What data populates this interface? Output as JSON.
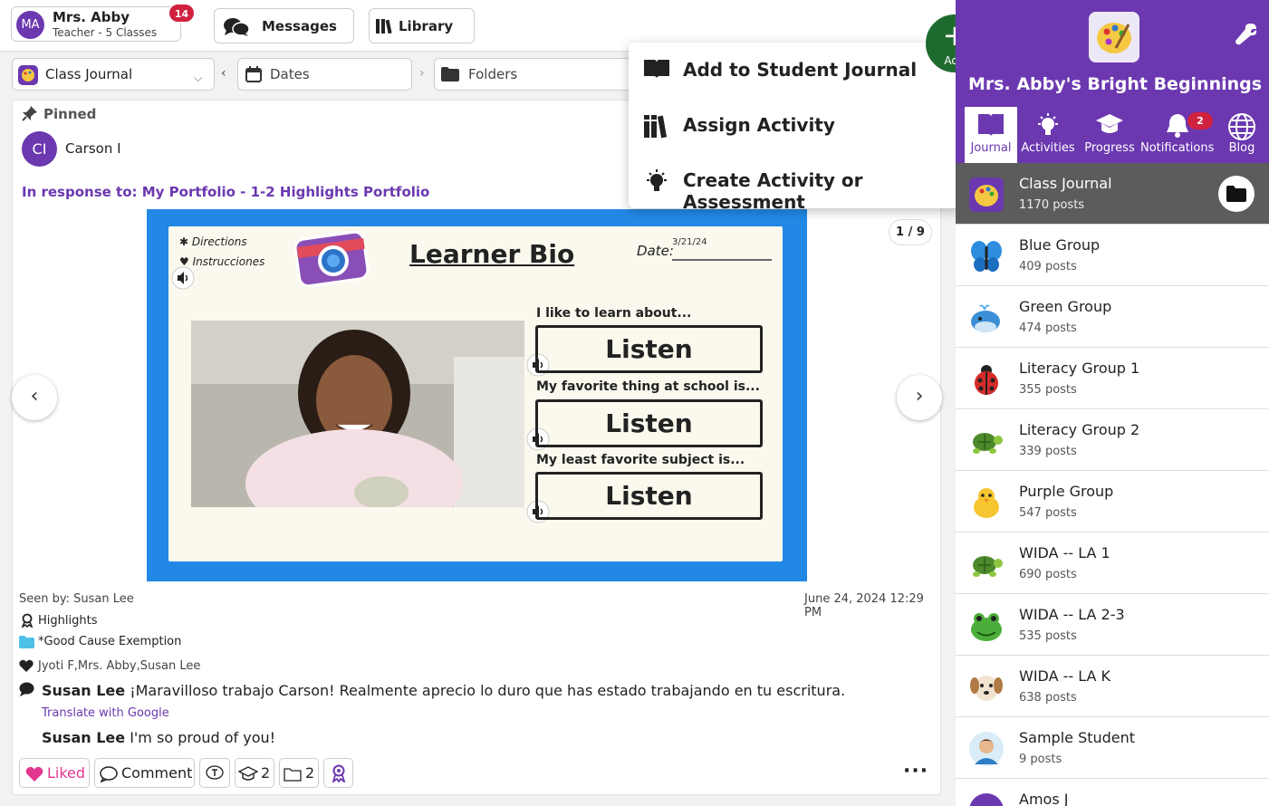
{
  "header": {
    "user_initials": "MA",
    "user_name": "Mrs. Abby",
    "user_role": "Teacher - 5 Classes",
    "notification_count": "14",
    "messages_label": "Messages",
    "library_label": "Library"
  },
  "filters": {
    "journal_select": "Class Journal",
    "dates_select": "Dates",
    "folders_select": "Folders"
  },
  "add_menu": {
    "button_label": "Add",
    "items": [
      "Add to Student Journal",
      "Assign Activity",
      "Create Activity or Assessment"
    ]
  },
  "post": {
    "pinned_label": "Pinned",
    "student_initials": "CI",
    "student_name": "Carson I",
    "response_text": "In response to: My Portfolio - 1-2 Highlights Portfolio",
    "page_counter": "1 / 9",
    "media": {
      "directions": "Directions",
      "instrucciones": "Instrucciones",
      "title": "Learner Bio",
      "date_label": "Date:",
      "date_value": "3/21/24",
      "prompts": [
        "I like to learn about...",
        "My favorite thing at school is...",
        "My least favorite subject is..."
      ],
      "listen_label": "Listen"
    },
    "seen_by": "Seen by: Susan Lee",
    "timestamp": "June 24, 2024 12:29 PM",
    "skill_tag": "Highlights",
    "folder_tag": "*Good Cause Exemption",
    "liked_by": "Jyoti F,Mrs. Abby,Susan Lee",
    "comments": [
      {
        "author": "Susan Lee",
        "text": "¡Maravilloso trabajo Carson! Realmente aprecio lo duro que has estado trabajando en tu escritura."
      },
      {
        "author": "Susan Lee",
        "text": "I'm so proud of you!"
      }
    ],
    "translate_label": "Translate with Google",
    "actions": {
      "liked_label": "Liked",
      "comment_label": "Comment",
      "skills_count": "2",
      "folders_count": "2"
    }
  },
  "sidebar": {
    "class_name": "Mrs. Abby's Bright Beginnings",
    "tabs": [
      "Journal",
      "Activities",
      "Progress",
      "Notifications",
      "Blog"
    ],
    "notifications_badge": "2",
    "groups": [
      {
        "name": "Class Journal",
        "posts": "1170 posts",
        "icon": "palette"
      },
      {
        "name": "Blue Group",
        "posts": "409 posts",
        "icon": "butterfly"
      },
      {
        "name": "Green Group",
        "posts": "474 posts",
        "icon": "whale"
      },
      {
        "name": "Literacy Group 1",
        "posts": "355 posts",
        "icon": "ladybug"
      },
      {
        "name": "Literacy Group 2",
        "posts": "339 posts",
        "icon": "turtle"
      },
      {
        "name": "Purple Group",
        "posts": "547 posts",
        "icon": "chick"
      },
      {
        "name": "WIDA -- LA 1",
        "posts": "690 posts",
        "icon": "turtle"
      },
      {
        "name": "WIDA -- LA 2-3",
        "posts": "535 posts",
        "icon": "frog"
      },
      {
        "name": "WIDA -- LA K",
        "posts": "638 posts",
        "icon": "dog"
      },
      {
        "name": "Sample Student",
        "posts": "9 posts",
        "icon": "student-avatar"
      },
      {
        "name": "Amos J",
        "posts": "",
        "icon": "student-avatar"
      }
    ]
  },
  "colors": {
    "brand_purple": "#6b38b0",
    "add_green": "#1f6b2f",
    "badge_red": "#d0213f",
    "like_pink": "#e2378f"
  }
}
